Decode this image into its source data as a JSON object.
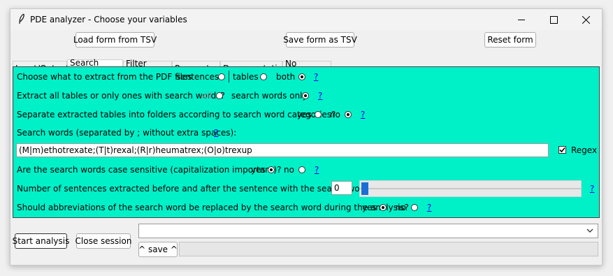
{
  "window": {
    "title": "PDE analyzer - Choose your variables"
  },
  "toolbar": {
    "load_label": "Load form from TSV",
    "save_label": "Save form as TSV",
    "reset_label": "Reset form"
  },
  "tabs": [
    {
      "label": "Input/Output"
    },
    {
      "label": "Search Words"
    },
    {
      "label": "Filter Words"
    },
    {
      "label": "Parameters"
    },
    {
      "label": "Documentation"
    },
    {
      "label": "No Output?"
    }
  ],
  "form": {
    "extract": {
      "question": "Choose what to extract from the PDF files",
      "opt1": "sentences",
      "opt2": "tables",
      "opt3": "both",
      "selected": "both",
      "help": "?"
    },
    "tables": {
      "question": "Extract all tables or only ones with search words?",
      "opt1": "all",
      "opt2": "search words only",
      "selected": "search words only",
      "help": "?"
    },
    "folders": {
      "question": "Separate extracted tables into folders according to search word categories?",
      "opt1": "yes",
      "opt2": "no",
      "selected": "no",
      "help": "?"
    },
    "search_words": {
      "label": "Search words (separated by ; without extra spaces):",
      "help": "?",
      "value": "(M|m)ethotrexate;(T|t)rexal;(R|r)heumatrex;(O|o)trexup",
      "regex_label": "Regex",
      "regex_checked": true
    },
    "case": {
      "question": "Are the search words case sensitive (capitalization important)?",
      "opt1": "yes",
      "opt2": "no",
      "selected": "yes",
      "help": "?"
    },
    "sentences": {
      "question": "Number of sentences extracted before and after the sentence with the search word:",
      "value": "0",
      "help": "?"
    },
    "abbrev": {
      "question": "Should abbreviations of the search word be replaced by the search word during the analysis?",
      "opt1": "yes",
      "opt2": "no",
      "selected": "yes",
      "help": "?"
    }
  },
  "bottom": {
    "start_label": "Start analysis",
    "close_label": "Close session",
    "save_label": "^ save ^",
    "dropdown_value": ""
  },
  "colors": {
    "panel": "#00f0c8",
    "link": "#0000ee",
    "slider": "#1a6fd4"
  }
}
